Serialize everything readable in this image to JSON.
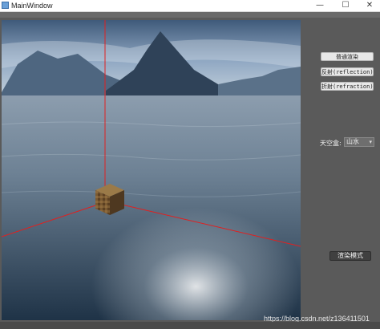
{
  "window": {
    "title": "MainWindow",
    "minimize_glyph": "—",
    "maximize_glyph": "☐",
    "close_glyph": "✕"
  },
  "panel": {
    "normal_render_label": "普通渲染",
    "reflection_label": "反射(reflection)",
    "refraction_label": "折射(refraction)",
    "skybox_label": "天空盒:",
    "skybox_selected": "山水",
    "render_mode_label": "渲染模式"
  },
  "footer": {
    "watermark": "https://blog.csdn.net/z136411501"
  },
  "icons": [
    "app-icon",
    "chevron-down-icon"
  ],
  "colors": {
    "axis_red": "#e02020",
    "background": "#5a5a5a"
  }
}
